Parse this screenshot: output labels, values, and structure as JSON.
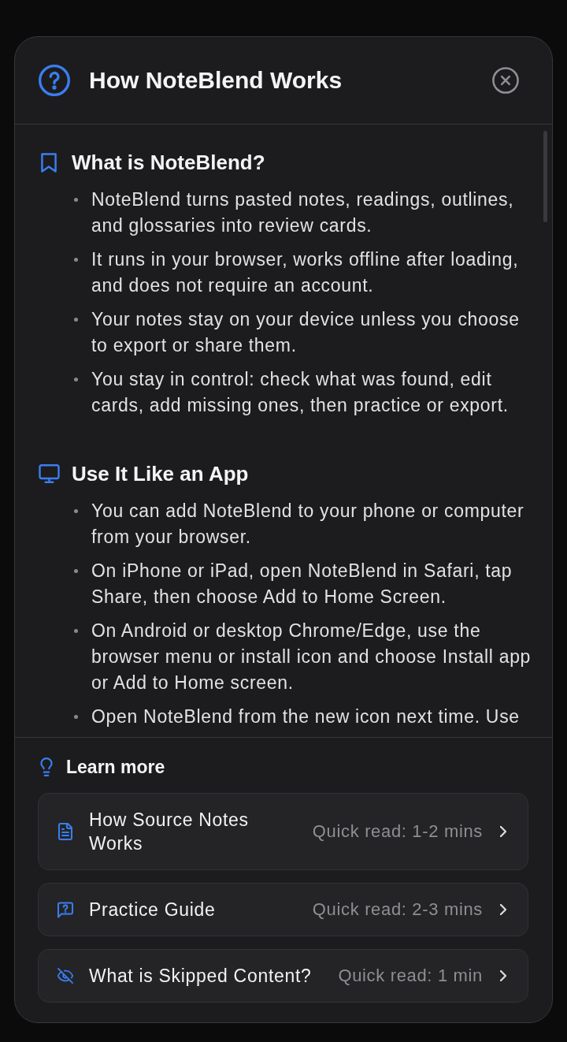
{
  "dialog": {
    "title": "How NoteBlend Works"
  },
  "sections": [
    {
      "kind": "bookmark",
      "heading": "What is NoteBlend?",
      "bullets": [
        "NoteBlend turns pasted notes, readings, outlines, and glossaries into review cards.",
        "It runs in your browser, works offline after loading, and does not require an account.",
        "Your notes stay on your device unless you choose to export or share them.",
        "You stay in control: check what was found, edit cards, add missing ones, then practice or export."
      ]
    },
    {
      "kind": "monitor",
      "heading": "Use It Like an App",
      "bullets": [
        "You can add NoteBlend to your phone or computer from your browser.",
        "On iPhone or iPad, open NoteBlend in Safari, tap Share, then choose Add to Home Screen.",
        "On Android or desktop Chrome/Edge, use the browser menu or install icon and choose Install app or Add to Home screen.",
        "Open NoteBlend from the new icon next time. Use"
      ]
    }
  ],
  "learn_more": {
    "heading": "Learn more",
    "items": [
      {
        "kind": "document",
        "title": "How Source Notes Works",
        "meta": "Quick read: 1-2 mins"
      },
      {
        "kind": "question-chat",
        "title": "Practice Guide",
        "meta": "Quick read: 2-3 mins"
      },
      {
        "kind": "hidden",
        "title": "What is Skipped Content?",
        "meta": "Quick read: 1 min"
      }
    ]
  }
}
